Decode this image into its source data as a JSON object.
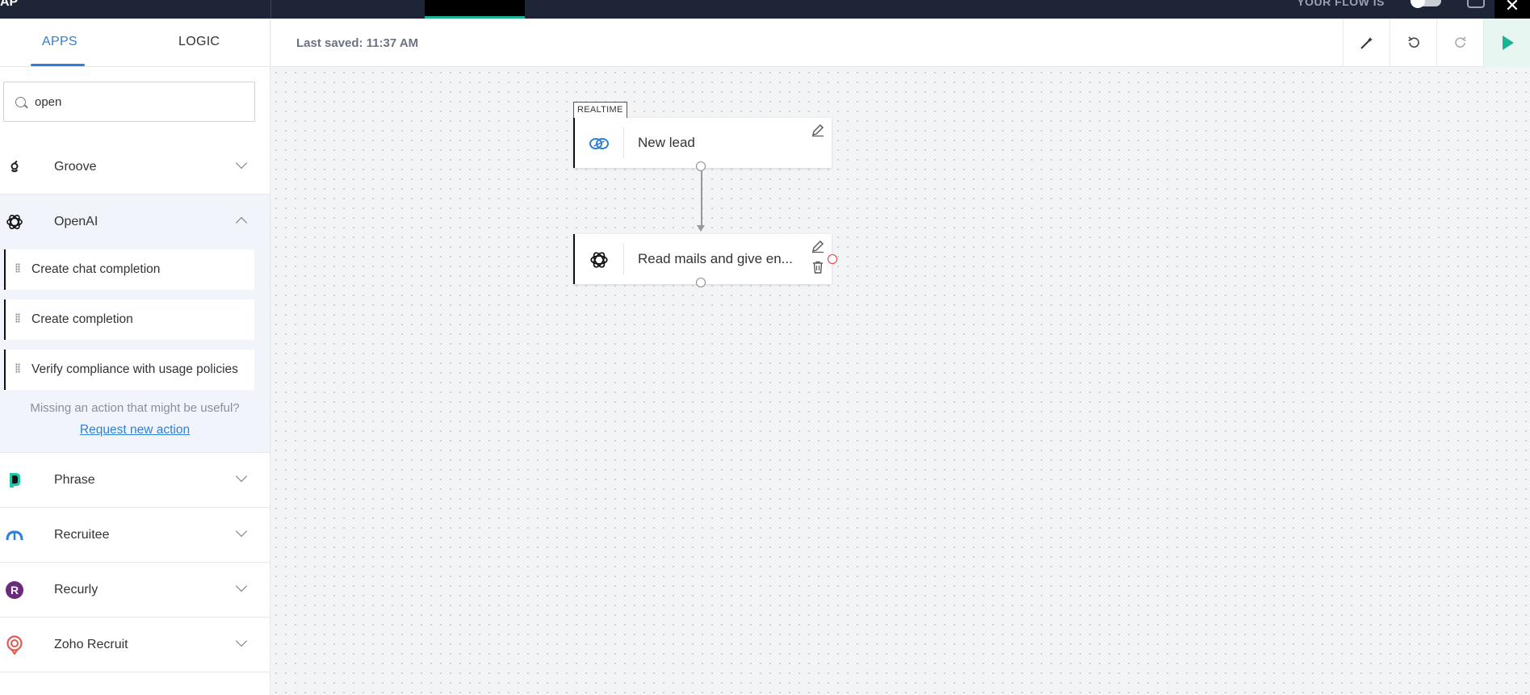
{
  "topbar": {
    "brand": "AP",
    "flow_label": "YOUR FLOW IS",
    "close_glyph": "✕"
  },
  "sidebar": {
    "tabs": [
      {
        "label": "APPS",
        "active": true
      },
      {
        "label": "LOGIC",
        "active": false
      }
    ],
    "search": {
      "value": "open"
    },
    "apps": [
      {
        "name": "Groove",
        "icon": "groove-icon",
        "expanded": false
      },
      {
        "name": "OpenAI",
        "icon": "openai-icon",
        "expanded": true,
        "actions": [
          "Create chat completion",
          "Create completion",
          "Verify compliance with usage policies"
        ],
        "missing_text": "Missing an action that might be useful?",
        "request_link": "Request new action"
      },
      {
        "name": "Phrase",
        "icon": "phrase-icon",
        "expanded": false
      },
      {
        "name": "Recruitee",
        "icon": "recruitee-icon",
        "expanded": false
      },
      {
        "name": "Recurly",
        "icon": "recurly-icon",
        "expanded": false
      },
      {
        "name": "Zoho Recruit",
        "icon": "zoho-recruit-icon",
        "expanded": false
      }
    ]
  },
  "header": {
    "last_saved": "Last saved: 11:37 AM",
    "buttons": [
      "magic-wand-icon",
      "undo-icon",
      "redo-icon",
      "play-icon"
    ]
  },
  "canvas": {
    "trigger": {
      "tag": "REALTIME",
      "title": "New lead",
      "icon": "zoho-crm-icon"
    },
    "action": {
      "title": "Read mails and give en...",
      "icon": "openai-icon",
      "has_error": true
    }
  },
  "colors": {
    "accent": "#2f7fd6",
    "topbar": "#1d2536",
    "run": "#1ab394",
    "error": "#e53935",
    "recurly": "#6b2a7c",
    "zoho_recruit": "#e05a4f",
    "phrase": "#1fc8a8"
  }
}
